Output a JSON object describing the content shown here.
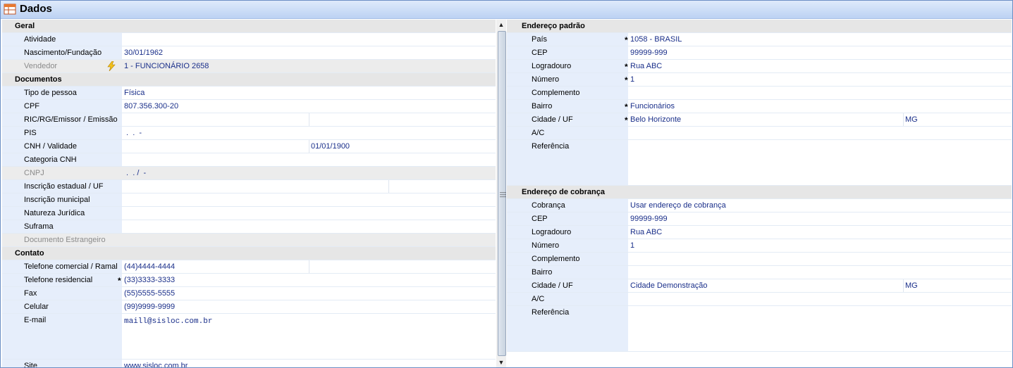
{
  "window": {
    "title": "Dados",
    "icon": "table-icon"
  },
  "left": {
    "geral": {
      "header": "Geral",
      "atividade": {
        "label": "Atividade",
        "value": ""
      },
      "nascimento": {
        "label": "Nascimento/Fundação",
        "value": "30/01/1962"
      },
      "vendedor": {
        "label": "Vendedor",
        "value": "1 - FUNCIONÁRIO 2658"
      }
    },
    "documentos": {
      "header": "Documentos",
      "tipo_pessoa": {
        "label": "Tipo de pessoa",
        "value": "Física"
      },
      "cpf": {
        "label": "CPF",
        "value": "807.356.300-20"
      },
      "ric": {
        "label": "RIC/RG/Emissor / Emissão",
        "value": ""
      },
      "pis": {
        "label": "PIS",
        "value": " .  .  -"
      },
      "cnh": {
        "label": "CNH / Validade",
        "value": "",
        "validade": "01/01/1900"
      },
      "categoria_cnh": {
        "label": "Categoria CNH",
        "value": ""
      },
      "cnpj": {
        "label": "CNPJ",
        "value": " .  . /  -"
      },
      "inscricao_estadual": {
        "label": "Inscrição estadual / UF",
        "value": ""
      },
      "inscricao_municipal": {
        "label": "Inscrição municipal",
        "value": ""
      },
      "natureza_juridica": {
        "label": "Natureza Jurídica",
        "value": ""
      },
      "suframa": {
        "label": "Suframa",
        "value": ""
      },
      "documento_estrangeiro": {
        "label": "Documento Estrangeiro",
        "value": ""
      }
    },
    "contato": {
      "header": "Contato",
      "tel_comercial": {
        "label": "Telefone comercial / Ramal",
        "value": "(44)4444-4444"
      },
      "tel_residencial": {
        "label": "Telefone residencial",
        "value": "(33)3333-3333"
      },
      "fax": {
        "label": "Fax",
        "value": "(55)5555-5555"
      },
      "celular": {
        "label": "Celular",
        "value": "(99)9999-9999"
      },
      "email": {
        "label": "E-mail",
        "value": "maill@sisloc.com.br"
      },
      "site": {
        "label": "Site",
        "value": "www.sisloc.com.br"
      }
    }
  },
  "right": {
    "endereco_padrao": {
      "header": "Endereço padrão",
      "pais": {
        "label": "País",
        "value": "1058 - BRASIL"
      },
      "cep": {
        "label": "CEP",
        "value": "99999-999"
      },
      "logradouro": {
        "label": "Logradouro",
        "value": "Rua ABC"
      },
      "numero": {
        "label": "Número",
        "value": "1"
      },
      "complemento": {
        "label": "Complemento",
        "value": ""
      },
      "bairro": {
        "label": "Bairro",
        "value": "Funcionários"
      },
      "cidade": {
        "label": "Cidade / UF",
        "value": "Belo Horizonte",
        "uf": "MG"
      },
      "ac": {
        "label": "A/C",
        "value": ""
      },
      "referencia": {
        "label": "Referência",
        "value": ""
      }
    },
    "endereco_cobranca": {
      "header": "Endereço de cobrança",
      "cobranca": {
        "label": "Cobrança",
        "value": "Usar endereço de cobrança"
      },
      "cep": {
        "label": "CEP",
        "value": "99999-999"
      },
      "logradouro": {
        "label": "Logradouro",
        "value": "Rua ABC"
      },
      "numero": {
        "label": "Número",
        "value": "1"
      },
      "complemento": {
        "label": "Complemento",
        "value": ""
      },
      "bairro": {
        "label": "Bairro",
        "value": ""
      },
      "cidade": {
        "label": "Cidade / UF",
        "value": "Cidade Demonstração",
        "uf": "MG"
      },
      "ac": {
        "label": "A/C",
        "value": ""
      },
      "referencia": {
        "label": "Referência",
        "value": ""
      }
    }
  },
  "scrollbar": {
    "up_icon": "arrow-up-icon",
    "down_icon": "arrow-down-icon",
    "grip_icon": "grip-icon"
  },
  "colors": {
    "label_bg": "#e6eefb",
    "value_text": "#1a2f8a",
    "required": "#e00000",
    "section_bg": "#e6e6e6"
  }
}
